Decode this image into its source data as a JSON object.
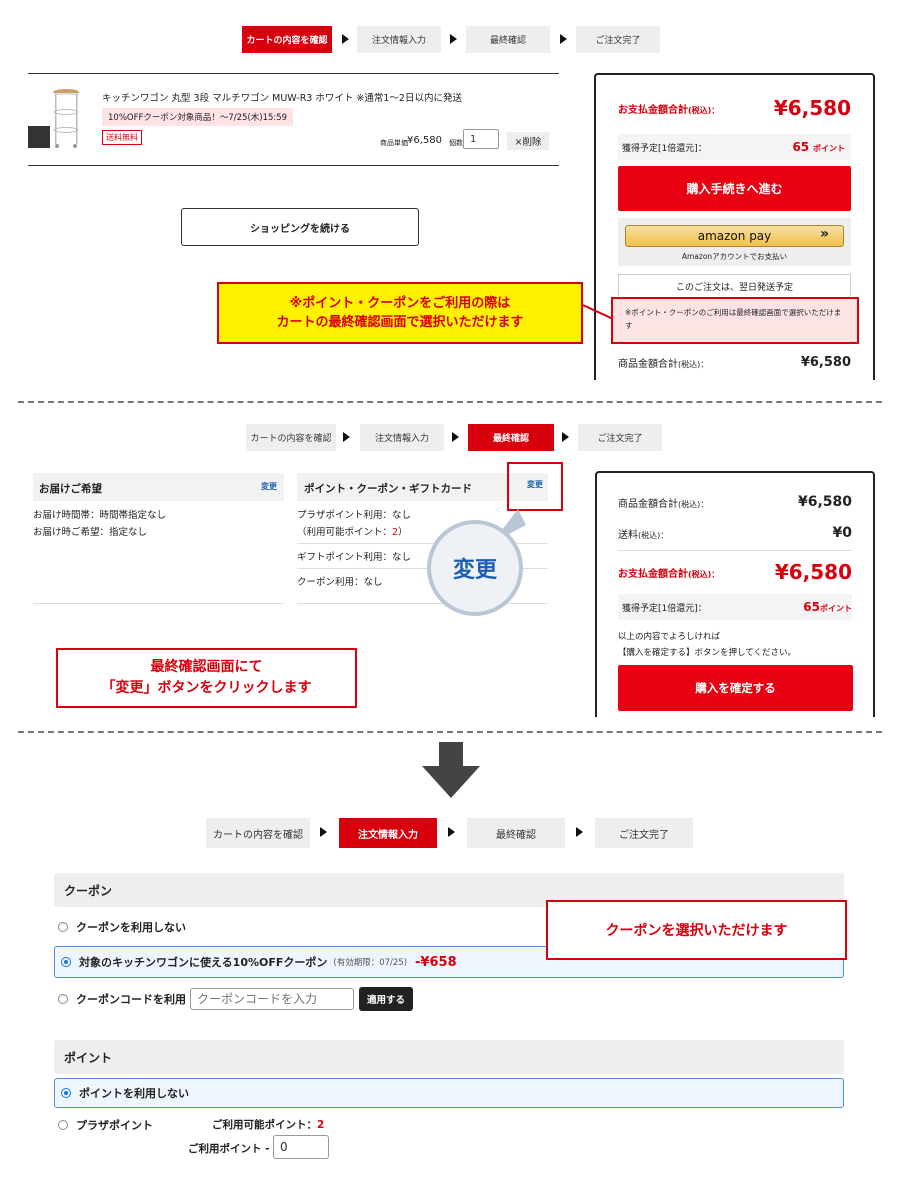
{
  "steps1": [
    "カートの内容を確認",
    "注文情報入力",
    "最終確認",
    "ご注文完了"
  ],
  "steps2": [
    "カートの内容を確認",
    "注文情報入力",
    "最終確認",
    "ご注文完了"
  ],
  "steps3": [
    "カートの内容を確認",
    "注文情報入力",
    "最終確認",
    "ご注文完了"
  ],
  "cart": {
    "product_name": "キッチンワゴン 丸型 3段 マルチワゴン MUW-R3 ホワイト ※通常1〜2日以内に発送",
    "coupon_badge": "10%OFFクーポン対象商品！〜7/25(木)15:59",
    "free_shipping": "送料無料",
    "unit_price_label": "商品単価",
    "unit_price": "¥6,580",
    "qty_label": "個数",
    "qty": "1",
    "delete_label": "×削除",
    "continue_label": "ショッピングを続ける",
    "thumb_text": "MUW-R3 キッチンワゴン"
  },
  "summary1": {
    "total_label": "お支払金額合計",
    "tax_label": "(税込)：",
    "total": "¥6,580",
    "points_label": "獲得予定[1倍還元]：",
    "points": "65",
    "points_unit": "ポイント",
    "checkout_label": "購入手続きへ進む",
    "amazon_logo": "amazon pay",
    "amazon_chev": "»",
    "amazon_sub": "Amazonアカウントでお支払い",
    "shipping_note": "このご注文は、翌日発送予定",
    "coupon_note": "※ポイント・クーポンのご利用は最終確認画面で選択いただけます",
    "subtotal_label": "商品金額合計",
    "subtotal_tax": "(税込)：",
    "subtotal": "¥6,580"
  },
  "callout1": {
    "line1": "※ポイント・クーポンをご利用の際は",
    "line2": "カートの最終確認画面で選択いただけます"
  },
  "confirm": {
    "delivery_title": "お届けご希望",
    "change_label": "変更",
    "delivery_time": "お届け時間帯：時間帯指定なし",
    "delivery_day": "お届け時ご希望：指定なし",
    "pcg_title": "ポイント・クーポン・ギフトカード",
    "change_label2": "変更",
    "plaza_use": "プラザポイント利用：なし",
    "plaza_avail_pre": "（利用可能ポイント：",
    "plaza_avail_val": "2",
    "plaza_avail_post": "）",
    "gift_use": "ギフトポイント利用：なし",
    "coupon_use": "クーポン利用：なし",
    "zoom_label": "変更"
  },
  "summary2": {
    "subtotal_label": "商品金額合計",
    "tax": "(税込)：",
    "subtotal": "¥6,580",
    "shipping_label": "送料",
    "shipping": "¥0",
    "total_label": "お支払金額合計",
    "total": "¥6,580",
    "points_label": "獲得予定[1倍還元]：",
    "points": "65",
    "points_unit": "ポイント",
    "note1": "以上の内容でよろしければ",
    "note2": "【購入を確定する】ボタンを押してください。",
    "confirm_label": "購入を確定する"
  },
  "callout2": {
    "line1": "最終確認画面にて",
    "line2": "「変更」ボタンをクリックします"
  },
  "order": {
    "coupon_title": "クーポン",
    "opt_none": "クーポンを利用しない",
    "opt_coupon": "対象のキッチンワゴンに使える10%OFFクーポン",
    "opt_coupon_exp": "(有効期限：07/25)",
    "opt_coupon_disc": "-¥658",
    "opt_code": "クーポンコードを利用",
    "code_placeholder": "クーポンコードを入力",
    "apply_label": "適用する",
    "point_title": "ポイント",
    "pt_none": "ポイントを利用しない",
    "pt_plaza": "プラザポイント",
    "pt_avail_label": "ご利用可能ポイント：",
    "pt_avail": "2",
    "pt_use_label": "ご利用ポイント",
    "pt_use_value": "0"
  },
  "callout3": {
    "text": "クーポンを選択いただけます"
  },
  "colors": {
    "brand_red": "#e60012",
    "amazon_yellow": "#f0c14b",
    "callout_yellow": "#fff200"
  }
}
